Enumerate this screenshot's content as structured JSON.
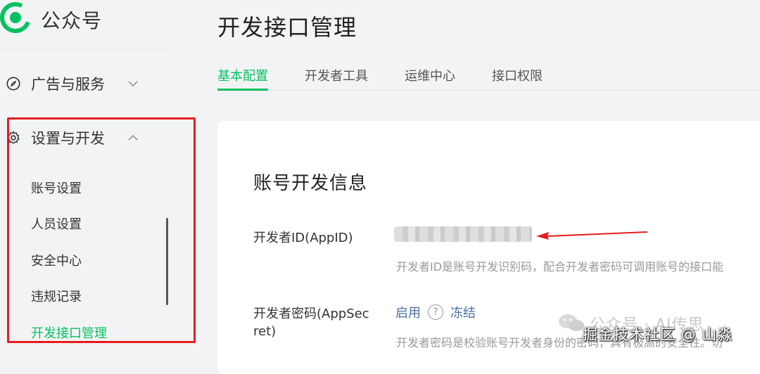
{
  "brand": {
    "name": "公众号"
  },
  "sidebar": {
    "groups": [
      {
        "label": "广告与服务",
        "icon": "compass-icon",
        "expanded": false
      },
      {
        "label": "设置与开发",
        "icon": "gear-icon",
        "expanded": true
      }
    ],
    "sub_items": [
      {
        "label": "账号设置"
      },
      {
        "label": "人员设置"
      },
      {
        "label": "安全中心"
      },
      {
        "label": "违规记录"
      },
      {
        "label": "开发接口管理",
        "active": true
      }
    ]
  },
  "page": {
    "title": "开发接口管理",
    "tabs": [
      {
        "label": "基本配置",
        "active": true
      },
      {
        "label": "开发者工具"
      },
      {
        "label": "运维中心"
      },
      {
        "label": "接口权限"
      }
    ]
  },
  "section": {
    "title": "账号开发信息",
    "app_id": {
      "label": "开发者ID(AppID)",
      "desc": "开发者ID是账号开发识别码，配合开发者密码可调用账号的接口能"
    },
    "app_secret": {
      "label_line1": "开发者密码(AppSec",
      "label_line2": "ret)",
      "enable": "启用",
      "help": "?",
      "freeze": "冻结",
      "desc": "开发者密码是校验账号开发者身份的密码，具有极高的安全性。切"
    }
  },
  "watermark": {
    "line1": "公众号 · AI传思",
    "line2": "掘金技术社区 @ 山淼"
  },
  "colors": {
    "accent": "#07c160",
    "annotation": "#e51d1d",
    "link": "#4a6fa5",
    "background": "#f2f3f5"
  }
}
